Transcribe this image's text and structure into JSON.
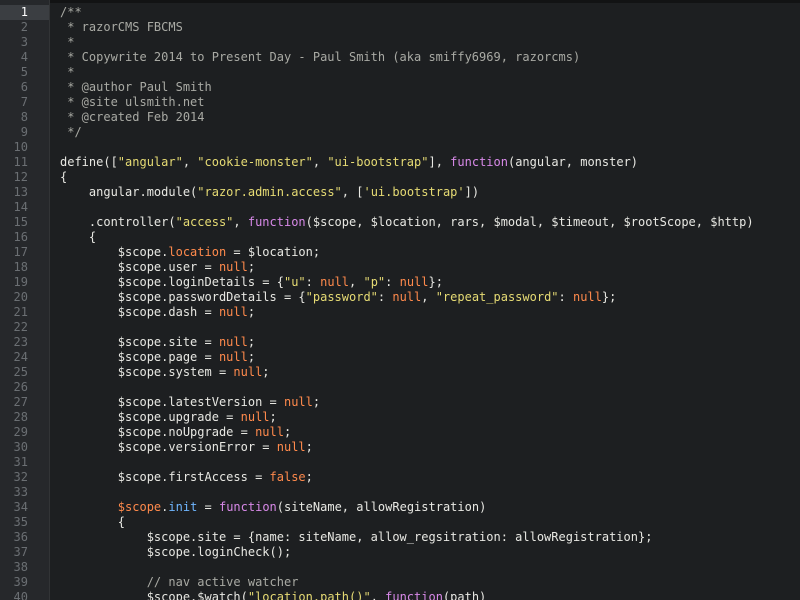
{
  "editor": {
    "active_line": 1,
    "lines": [
      {
        "n": "1",
        "tokens": [
          {
            "t": "/**",
            "c": "comment"
          }
        ]
      },
      {
        "n": "2",
        "tokens": [
          {
            "t": " * razorCMS FBCMS",
            "c": "comment"
          }
        ]
      },
      {
        "n": "3",
        "tokens": [
          {
            "t": " *",
            "c": "comment"
          }
        ]
      },
      {
        "n": "4",
        "tokens": [
          {
            "t": " * Copywrite 2014 to Present Day - Paul Smith (aka smiffy6969, razorcms)",
            "c": "comment"
          }
        ]
      },
      {
        "n": "5",
        "tokens": [
          {
            "t": " *",
            "c": "comment"
          }
        ]
      },
      {
        "n": "6",
        "tokens": [
          {
            "t": " * @author Paul Smith",
            "c": "comment"
          }
        ]
      },
      {
        "n": "7",
        "tokens": [
          {
            "t": " * @site ulsmith.net",
            "c": "comment"
          }
        ]
      },
      {
        "n": "8",
        "tokens": [
          {
            "t": " * @created Feb 2014",
            "c": "comment"
          }
        ]
      },
      {
        "n": "9",
        "tokens": [
          {
            "t": " */",
            "c": "comment"
          }
        ]
      },
      {
        "n": "10",
        "tokens": []
      },
      {
        "n": "11",
        "tokens": [
          {
            "t": "define([",
            "c": "plain"
          },
          {
            "t": "\"angular\"",
            "c": "string"
          },
          {
            "t": ", ",
            "c": "plain"
          },
          {
            "t": "\"cookie-monster\"",
            "c": "string"
          },
          {
            "t": ", ",
            "c": "plain"
          },
          {
            "t": "\"ui-bootstrap\"",
            "c": "string"
          },
          {
            "t": "], ",
            "c": "plain"
          },
          {
            "t": "function",
            "c": "keyword"
          },
          {
            "t": "(angular, monster)",
            "c": "plain"
          }
        ]
      },
      {
        "n": "12",
        "tokens": [
          {
            "t": "{",
            "c": "plain"
          }
        ]
      },
      {
        "n": "13",
        "tokens": [
          {
            "t": "    angular.module(",
            "c": "plain"
          },
          {
            "t": "\"razor.admin.access\"",
            "c": "string"
          },
          {
            "t": ", [",
            "c": "plain"
          },
          {
            "t": "'ui.bootstrap'",
            "c": "string"
          },
          {
            "t": "])",
            "c": "plain"
          }
        ]
      },
      {
        "n": "14",
        "tokens": []
      },
      {
        "n": "15",
        "tokens": [
          {
            "t": "    .controller(",
            "c": "plain"
          },
          {
            "t": "\"access\"",
            "c": "string"
          },
          {
            "t": ", ",
            "c": "plain"
          },
          {
            "t": "function",
            "c": "keyword"
          },
          {
            "t": "($scope, $location, rars, $modal, $timeout, $rootScope, $http)",
            "c": "plain"
          }
        ]
      },
      {
        "n": "16",
        "tokens": [
          {
            "t": "    {",
            "c": "plain"
          }
        ]
      },
      {
        "n": "17",
        "tokens": [
          {
            "t": "        $scope.",
            "c": "plain"
          },
          {
            "t": "location",
            "c": "prop"
          },
          {
            "t": " = $location;",
            "c": "plain"
          }
        ]
      },
      {
        "n": "18",
        "tokens": [
          {
            "t": "        $scope.user = ",
            "c": "plain"
          },
          {
            "t": "null",
            "c": "value"
          },
          {
            "t": ";",
            "c": "plain"
          }
        ]
      },
      {
        "n": "19",
        "tokens": [
          {
            "t": "        $scope.loginDetails = {",
            "c": "plain"
          },
          {
            "t": "\"u\"",
            "c": "string"
          },
          {
            "t": ": ",
            "c": "plain"
          },
          {
            "t": "null",
            "c": "value"
          },
          {
            "t": ", ",
            "c": "plain"
          },
          {
            "t": "\"p\"",
            "c": "string"
          },
          {
            "t": ": ",
            "c": "plain"
          },
          {
            "t": "null",
            "c": "value"
          },
          {
            "t": "};",
            "c": "plain"
          }
        ]
      },
      {
        "n": "20",
        "tokens": [
          {
            "t": "        $scope.passwordDetails = {",
            "c": "plain"
          },
          {
            "t": "\"password\"",
            "c": "string"
          },
          {
            "t": ": ",
            "c": "plain"
          },
          {
            "t": "null",
            "c": "value"
          },
          {
            "t": ", ",
            "c": "plain"
          },
          {
            "t": "\"repeat_password\"",
            "c": "string"
          },
          {
            "t": ": ",
            "c": "plain"
          },
          {
            "t": "null",
            "c": "value"
          },
          {
            "t": "};",
            "c": "plain"
          }
        ]
      },
      {
        "n": "21",
        "tokens": [
          {
            "t": "        $scope.dash = ",
            "c": "plain"
          },
          {
            "t": "null",
            "c": "value"
          },
          {
            "t": ";",
            "c": "plain"
          }
        ]
      },
      {
        "n": "22",
        "tokens": []
      },
      {
        "n": "23",
        "tokens": [
          {
            "t": "        $scope.site = ",
            "c": "plain"
          },
          {
            "t": "null",
            "c": "value"
          },
          {
            "t": ";",
            "c": "plain"
          }
        ]
      },
      {
        "n": "24",
        "tokens": [
          {
            "t": "        $scope.page = ",
            "c": "plain"
          },
          {
            "t": "null",
            "c": "value"
          },
          {
            "t": ";",
            "c": "plain"
          }
        ]
      },
      {
        "n": "25",
        "tokens": [
          {
            "t": "        $scope.system = ",
            "c": "plain"
          },
          {
            "t": "null",
            "c": "value"
          },
          {
            "t": ";",
            "c": "plain"
          }
        ]
      },
      {
        "n": "26",
        "tokens": []
      },
      {
        "n": "27",
        "tokens": [
          {
            "t": "        $scope.latestVersion = ",
            "c": "plain"
          },
          {
            "t": "null",
            "c": "value"
          },
          {
            "t": ";",
            "c": "plain"
          }
        ]
      },
      {
        "n": "28",
        "tokens": [
          {
            "t": "        $scope.upgrade = ",
            "c": "plain"
          },
          {
            "t": "null",
            "c": "value"
          },
          {
            "t": ";",
            "c": "plain"
          }
        ]
      },
      {
        "n": "29",
        "tokens": [
          {
            "t": "        $scope.noUpgrade = ",
            "c": "plain"
          },
          {
            "t": "null",
            "c": "value"
          },
          {
            "t": ";",
            "c": "plain"
          }
        ]
      },
      {
        "n": "30",
        "tokens": [
          {
            "t": "        $scope.versionError = ",
            "c": "plain"
          },
          {
            "t": "null",
            "c": "value"
          },
          {
            "t": ";",
            "c": "plain"
          }
        ]
      },
      {
        "n": "31",
        "tokens": []
      },
      {
        "n": "32",
        "tokens": [
          {
            "t": "        $scope.firstAccess = ",
            "c": "plain"
          },
          {
            "t": "false",
            "c": "value"
          },
          {
            "t": ";",
            "c": "plain"
          }
        ]
      },
      {
        "n": "33",
        "tokens": []
      },
      {
        "n": "34",
        "tokens": [
          {
            "t": "        ",
            "c": "plain"
          },
          {
            "t": "$scope",
            "c": "prop"
          },
          {
            "t": ".",
            "c": "plain"
          },
          {
            "t": "init",
            "c": "watch"
          },
          {
            "t": " = ",
            "c": "plain"
          },
          {
            "t": "function",
            "c": "keyword"
          },
          {
            "t": "(siteName, allowRegistration)",
            "c": "plain"
          }
        ]
      },
      {
        "n": "35",
        "tokens": [
          {
            "t": "        {",
            "c": "plain"
          }
        ]
      },
      {
        "n": "36",
        "tokens": [
          {
            "t": "            $scope.site = {name: siteName, allow_regsitration: allowRegistration};",
            "c": "plain"
          }
        ]
      },
      {
        "n": "37",
        "tokens": [
          {
            "t": "            $scope.loginCheck();",
            "c": "plain"
          }
        ]
      },
      {
        "n": "38",
        "tokens": []
      },
      {
        "n": "39",
        "tokens": [
          {
            "t": "            // nav active watcher",
            "c": "comment"
          }
        ]
      },
      {
        "n": "40",
        "tokens": [
          {
            "t": "            $scope.$watch(",
            "c": "plain"
          },
          {
            "t": "\"location.path()\"",
            "c": "string"
          },
          {
            "t": ", ",
            "c": "plain"
          },
          {
            "t": "function",
            "c": "keyword"
          },
          {
            "t": "(path)",
            "c": "plain"
          }
        ]
      }
    ]
  }
}
